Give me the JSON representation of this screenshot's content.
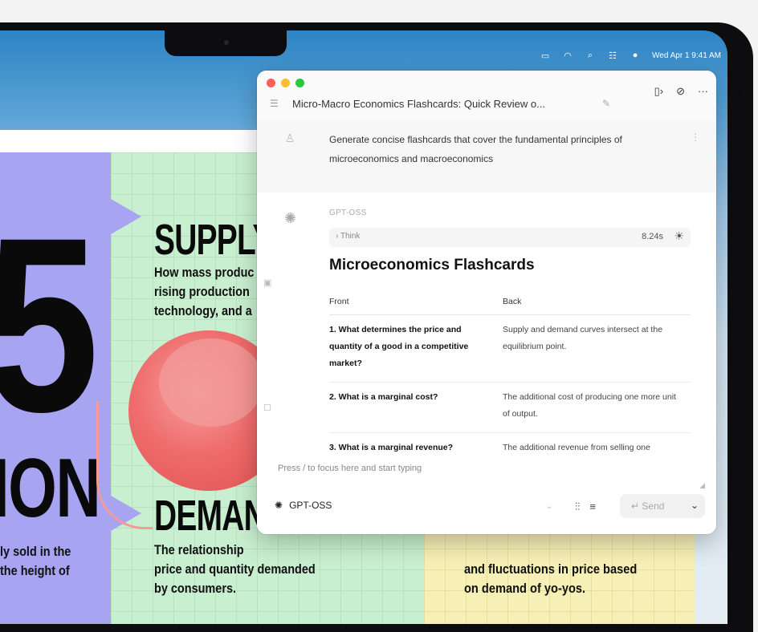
{
  "menubar": {
    "datetime": "Wed Apr 1  9:41 AM",
    "icons": [
      "battery-icon",
      "wifi-icon",
      "search-icon",
      "control-center-icon",
      "siri-icon"
    ]
  },
  "poster": {
    "big_number": "5",
    "big_word": "ION",
    "left_body_line1": "ly sold in the",
    "left_body_line2": "the height of",
    "supply_heading": "SUPPLY",
    "supply_line1": "How mass produc",
    "supply_line2": "rising production",
    "supply_line3": "technology, and a",
    "demand_heading": "DEMAND",
    "demand_line1": "The relationship",
    "demand_line2": "price and quantity demanded",
    "demand_line3": "by consumers.",
    "yellow_line1": "and fluctuations in price based",
    "yellow_line2": "on demand of yo-yos."
  },
  "window": {
    "title": "Micro-Macro Economics Flashcards: Quick Review o...",
    "prompt": "Generate concise flashcards that cover the fundamental principles of microeconomics and macroeconomics",
    "model_label": "GPT-OSS",
    "think_label": "Think",
    "think_time": "8.24s",
    "heading": "Microeconomics Flashcards",
    "table": {
      "headers": [
        "Front",
        "Back"
      ],
      "rows": [
        {
          "front": "1. What determines the price and quantity of a good in a competitive market?",
          "back": "Supply and demand curves intersect at the equilibrium point."
        },
        {
          "front": "2. What is a marginal cost?",
          "back": "The additional cost of producing one more unit of output."
        },
        {
          "front": "3. What is a marginal revenue?",
          "back": "The additional revenue from selling one"
        }
      ]
    },
    "input_placeholder": "Press / to focus here and start typing",
    "model_select": "GPT-OSS",
    "send_label": "Send"
  },
  "colors": {
    "traffic_red": "#ff5f57",
    "traffic_yellow": "#febc2e",
    "traffic_green": "#28c840",
    "poster_purple": "#a7a4f2",
    "poster_green": "#c8efcf",
    "poster_yellow": "#f6efb6",
    "yoyo_red": "#ef6d6d"
  }
}
